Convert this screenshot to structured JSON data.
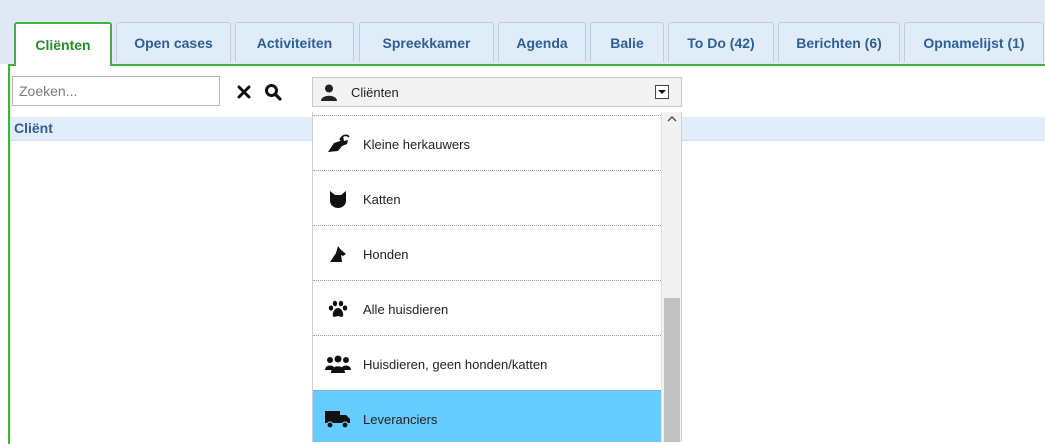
{
  "tabs": [
    {
      "label": "Cliënten",
      "active": true
    },
    {
      "label": "Open cases"
    },
    {
      "label": "Activiteiten"
    },
    {
      "label": "Spreekkamer"
    },
    {
      "label": "Agenda"
    },
    {
      "label": "Balie"
    },
    {
      "label": "To Do (42)"
    },
    {
      "label": "Berichten (6)"
    },
    {
      "label": "Opnamelijst (1)"
    }
  ],
  "search": {
    "placeholder": "Zoeken...",
    "value": ""
  },
  "filter_select": {
    "selected": "Cliënten",
    "icon": "user-icon"
  },
  "table": {
    "columns": [
      "Cliënt"
    ]
  },
  "dropdown_options": [
    {
      "label": "Kleine herkauwers",
      "icon": "goat-icon"
    },
    {
      "label": "Katten",
      "icon": "cat-icon"
    },
    {
      "label": "Honden",
      "icon": "dog-icon"
    },
    {
      "label": "Alle huisdieren",
      "icon": "paw-icon"
    },
    {
      "label": "Huisdieren, geen honden/katten",
      "icon": "users-icon"
    },
    {
      "label": "Leveranciers",
      "icon": "truck-icon",
      "selected": true
    }
  ],
  "colors": {
    "accent_green": "#3eb33e",
    "tab_text": "#2f5f94",
    "selected_row": "#66ccff"
  }
}
